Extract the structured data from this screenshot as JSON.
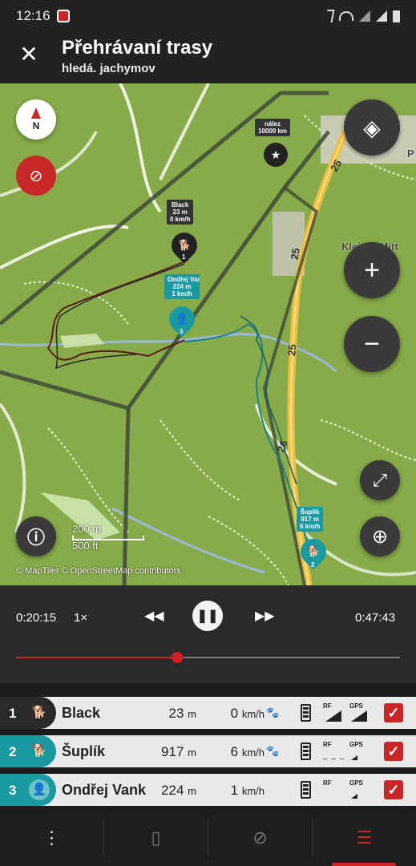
{
  "status_bar": {
    "time": "12:16"
  },
  "app_bar": {
    "title": "Přehrávaní trasy",
    "subtitle": "hledá. jachymov"
  },
  "map": {
    "markers": [
      {
        "name": "nález",
        "detail": "10000 km",
        "icon": "star-icon"
      },
      {
        "name": "Black",
        "distance": "23 m",
        "speed": "0 km/h",
        "number": "1",
        "icon": "dog-icon"
      },
      {
        "name": "Ondřej Vank",
        "distance": "224 m",
        "speed": "1 km/h",
        "number": "3",
        "icon": "person-icon"
      },
      {
        "name": "Šuplík",
        "distance": "917 m",
        "speed": "6 km/h",
        "number": "2",
        "icon": "dog-icon"
      }
    ],
    "place_labels": [
      "Kleiner Mitt",
      "P"
    ],
    "road_numbers": [
      "25",
      "25",
      "25",
      "26"
    ],
    "scale": {
      "metric": "200 m",
      "imperial": "500 ft"
    },
    "attribution": "© MapTiler © OpenStreetMap contributors",
    "compass_label": "N"
  },
  "playback": {
    "current_time": "0:20:15",
    "speed": "1×",
    "end_time": "0:47:43",
    "progress": 0.42
  },
  "tracked": [
    {
      "index": "1",
      "name": "Black",
      "distance": "23",
      "distance_unit": "m",
      "speed": "0",
      "speed_unit": "km/h",
      "color": "#2a2a2a",
      "checked": true
    },
    {
      "index": "2",
      "name": "Šuplík",
      "distance": "917",
      "distance_unit": "m",
      "speed": "6",
      "speed_unit": "km/h",
      "color": "#1a9aa0",
      "checked": true
    },
    {
      "index": "3",
      "name": "Ondřej Vank",
      "distance": "224",
      "distance_unit": "m",
      "speed": "1",
      "speed_unit": "km/h",
      "color": "#1a9aa0",
      "checked": true
    }
  ],
  "signal_labels": {
    "rf": "RF",
    "gps": "GPS"
  },
  "bottom_nav": [
    "more-icon",
    "collar-icon",
    "compass-icon",
    "list-icon"
  ],
  "colors": {
    "accent": "#c62828",
    "teal": "#1a9aa0",
    "map_green": "#86ab48"
  }
}
